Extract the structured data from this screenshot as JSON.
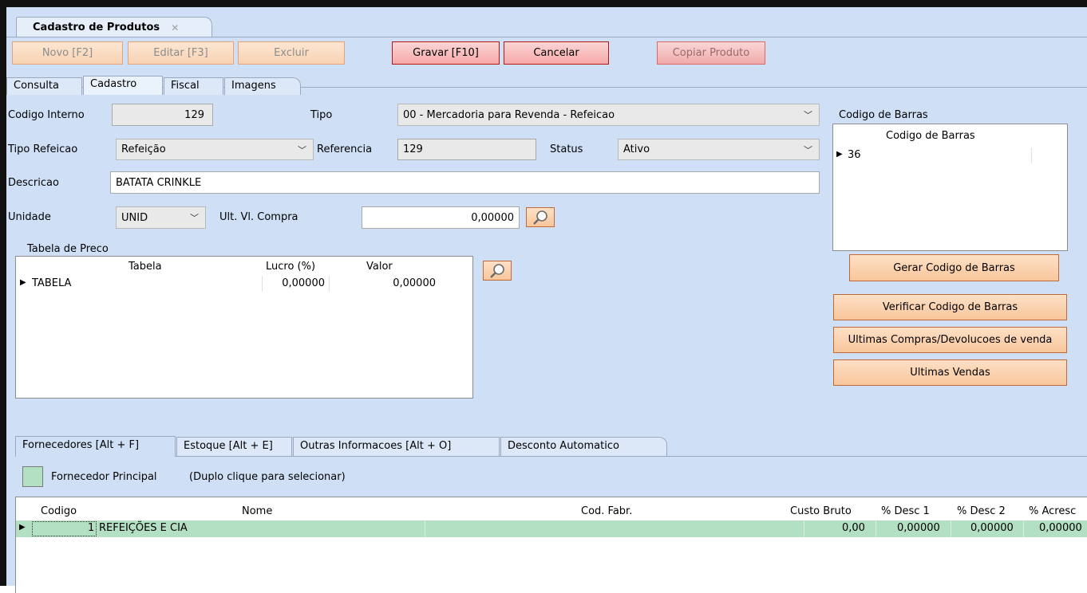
{
  "doc_tab": {
    "title": "Cadastro de Produtos",
    "close": "✕"
  },
  "toolbar": {
    "novo": "Novo [F2]",
    "editar": "Editar [F3]",
    "excluir": "Excluir",
    "gravar": "Gravar [F10]",
    "cancelar": "Cancelar",
    "copiar": "Copiar Produto"
  },
  "main_tabs": [
    "Consulta",
    "Cadastro",
    "Fiscal",
    "Imagens"
  ],
  "form": {
    "codigo_interno_label": "Codigo Interno",
    "codigo_interno_value": "129",
    "tipo_label": "Tipo",
    "tipo_value": "00 - Mercadoria para Revenda - Refeicao",
    "tipo_refeicao_label": "Tipo Refeicao",
    "tipo_refeicao_value": "Refeição",
    "referencia_label": "Referencia",
    "referencia_value": "129",
    "status_label": "Status",
    "status_value": "Ativo",
    "descricao_label": "Descricao",
    "descricao_value": "BATATA CRINKLE",
    "unidade_label": "Unidade",
    "unidade_value": "UNID",
    "ult_compra_label": "Ult. Vl. Compra",
    "ult_compra_value": "0,00000"
  },
  "tabela_preco": {
    "group_label": "Tabela de Preco",
    "columns": [
      "Tabela",
      "Lucro (%)",
      "Valor"
    ],
    "rows": [
      {
        "tabela": "TABELA",
        "lucro": "0,00000",
        "valor": "0,00000"
      }
    ]
  },
  "codigo_barras": {
    "group_label": "Codigo de Barras",
    "column": "Codigo de Barras",
    "rows": [
      "36"
    ]
  },
  "side_buttons": {
    "gerar": "Gerar Codigo de Barras",
    "verificar": "Verificar Codigo de Barras",
    "ultimas_compras": "Ultimas Compras/Devolucoes de venda",
    "ultimas_vendas": "Ultimas Vendas"
  },
  "sub_tabs": [
    "Fornecedores [Alt + F]",
    "Estoque [Alt + E]",
    "Outras Informacoes [Alt + O]",
    "Desconto Automatico"
  ],
  "legend": {
    "label": "Fornecedor Principal",
    "hint": "(Duplo clique para selecionar)",
    "color": "#b3dfc2"
  },
  "fornecedores": {
    "columns": [
      "Codigo",
      "Nome",
      "Cod. Fabr.",
      "Custo Bruto",
      "% Desc 1",
      "% Desc 2",
      "% Acresc"
    ],
    "rows": [
      {
        "codigo": "1",
        "nome": "REFEIÇÕES E CIA",
        "cod_fabr": "",
        "custo_bruto": "0,00",
        "desc1": "0,00000",
        "desc2": "0,00000",
        "acresc": "0,00000"
      }
    ]
  }
}
